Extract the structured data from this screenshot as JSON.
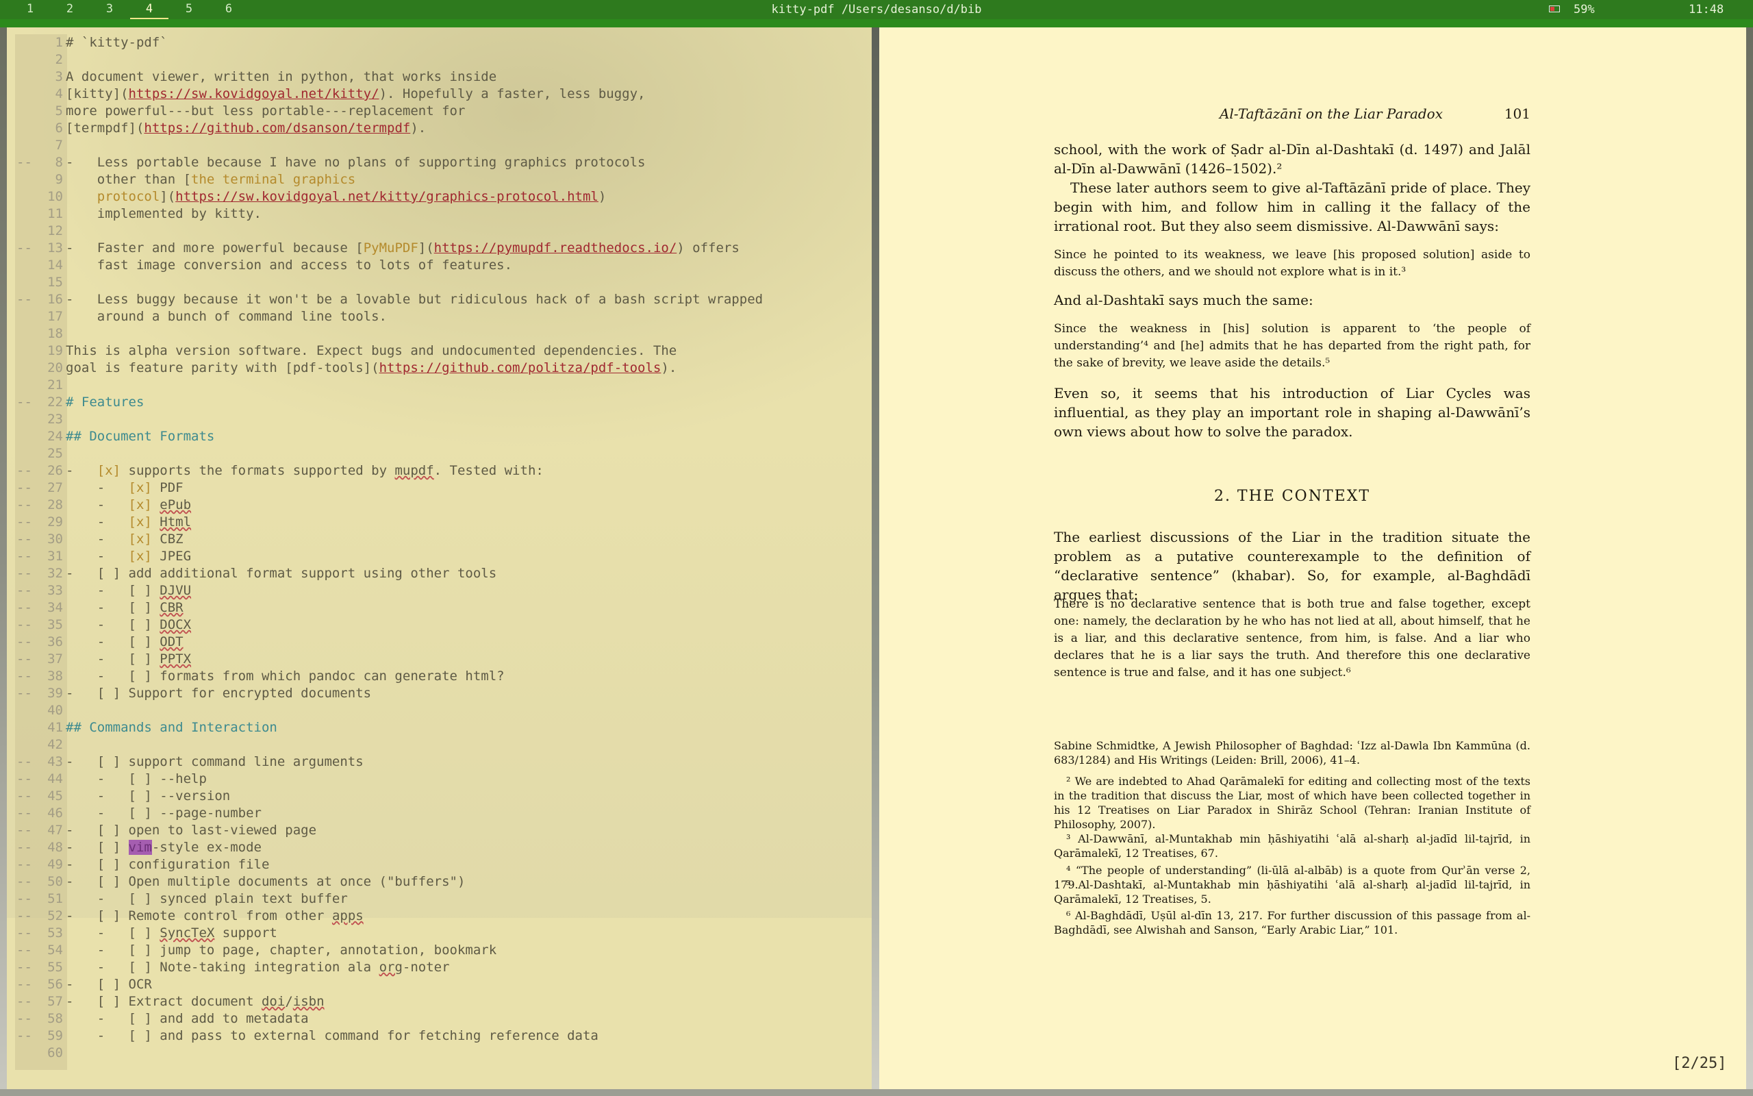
{
  "topbar": {
    "workspaces": [
      "1",
      "2",
      "3",
      "4",
      "5",
      "6"
    ],
    "active_workspace": "4",
    "window_title": "kitty-pdf /Users/desanso/d/bib",
    "battery": "59%",
    "clock": "11:48"
  },
  "editor": {
    "lines": [
      {
        "n": "1",
        "m": "",
        "t": [
          [
            "# `kitty-pdf`",
            ""
          ]
        ]
      },
      {
        "n": "2",
        "m": "",
        "t": []
      },
      {
        "n": "3",
        "m": "",
        "t": [
          [
            "A document viewer, written in python, that works inside",
            ""
          ]
        ]
      },
      {
        "n": "4",
        "m": "",
        "t": [
          [
            "[kitty](",
            ""
          ],
          [
            "https://sw.kovidgoyal.net/kitty/",
            "lnk"
          ],
          [
            "). Hopefully a faster, less buggy,",
            ""
          ]
        ]
      },
      {
        "n": "5",
        "m": "",
        "t": [
          [
            "more powerful---but less portable---replacement for",
            ""
          ]
        ]
      },
      {
        "n": "6",
        "m": "",
        "t": [
          [
            "[termpdf](",
            ""
          ],
          [
            "https://github.com/dsanson/termpdf",
            "lnk"
          ],
          [
            ").",
            ""
          ]
        ]
      },
      {
        "n": "7",
        "m": "",
        "t": []
      },
      {
        "n": "8",
        "m": "--",
        "t": [
          [
            "-   Less portable because I have no plans of supporting graphics protocols",
            ""
          ]
        ]
      },
      {
        "n": "9",
        "m": "",
        "t": [
          [
            "    other than [",
            ""
          ],
          [
            "the terminal graphics",
            "gld"
          ]
        ]
      },
      {
        "n": "10",
        "m": "",
        "t": [
          [
            "    ",
            ""
          ],
          [
            "protocol",
            "gld"
          ],
          [
            "](",
            ""
          ],
          [
            "https://sw.kovidgoyal.net/kitty/graphics-protocol.html",
            "lnk"
          ],
          [
            ")",
            ""
          ]
        ]
      },
      {
        "n": "11",
        "m": "",
        "t": [
          [
            "    implemented by kitty.",
            ""
          ]
        ]
      },
      {
        "n": "12",
        "m": "",
        "t": []
      },
      {
        "n": "13",
        "m": "--",
        "t": [
          [
            "-   Faster and more powerful because [",
            ""
          ],
          [
            "PyMuPDF",
            "gld"
          ],
          [
            "](",
            ""
          ],
          [
            "https://pymupdf.readthedocs.io/",
            "lnk"
          ],
          [
            ") offers",
            ""
          ]
        ]
      },
      {
        "n": "14",
        "m": "",
        "t": [
          [
            "    fast image conversion and access to lots of features.",
            ""
          ]
        ]
      },
      {
        "n": "15",
        "m": "",
        "t": []
      },
      {
        "n": "16",
        "m": "--",
        "t": [
          [
            "-   Less buggy because it won't be a lovable but ridiculous hack of a bash script wrapped",
            ""
          ]
        ]
      },
      {
        "n": "17",
        "m": "",
        "t": [
          [
            "    around a bunch of command line tools.",
            ""
          ]
        ]
      },
      {
        "n": "18",
        "m": "",
        "t": []
      },
      {
        "n": "19",
        "m": "",
        "t": [
          [
            "This is alpha version software. Expect bugs and undocumented dependencies. The",
            ""
          ]
        ]
      },
      {
        "n": "20",
        "m": "",
        "t": [
          [
            "goal is feature parity with [pdf-tools](",
            ""
          ],
          [
            "https://github.com/politza/pdf-tools",
            "lnk"
          ],
          [
            ").",
            ""
          ]
        ]
      },
      {
        "n": "21",
        "m": "",
        "t": []
      },
      {
        "n": "22",
        "m": "--",
        "t": [
          [
            "# Features",
            "h"
          ]
        ]
      },
      {
        "n": "23",
        "m": "",
        "t": []
      },
      {
        "n": "24",
        "m": "",
        "t": [
          [
            "## Document Formats",
            "h"
          ]
        ]
      },
      {
        "n": "25",
        "m": "",
        "t": []
      },
      {
        "n": "26",
        "m": "--",
        "t": [
          [
            "-   ",
            ""
          ],
          [
            "[x]",
            "gld"
          ],
          [
            " supports the formats supported by ",
            ""
          ],
          [
            "mupdf",
            "spl"
          ],
          [
            ". Tested with:",
            ""
          ]
        ]
      },
      {
        "n": "27",
        "m": "--",
        "t": [
          [
            "    -   ",
            ""
          ],
          [
            "[x]",
            "gld"
          ],
          [
            " PDF",
            ""
          ]
        ]
      },
      {
        "n": "28",
        "m": "--",
        "t": [
          [
            "    -   ",
            ""
          ],
          [
            "[x]",
            "gld"
          ],
          [
            " ",
            ""
          ],
          [
            "ePub",
            "spl"
          ]
        ]
      },
      {
        "n": "29",
        "m": "--",
        "t": [
          [
            "    -   ",
            ""
          ],
          [
            "[x]",
            "gld"
          ],
          [
            " ",
            ""
          ],
          [
            "Html",
            "spl"
          ]
        ]
      },
      {
        "n": "30",
        "m": "--",
        "t": [
          [
            "    -   ",
            ""
          ],
          [
            "[x]",
            "gld"
          ],
          [
            " CBZ",
            ""
          ]
        ]
      },
      {
        "n": "31",
        "m": "--",
        "t": [
          [
            "    -   ",
            ""
          ],
          [
            "[x]",
            "gld"
          ],
          [
            " JPEG",
            ""
          ]
        ]
      },
      {
        "n": "32",
        "m": "--",
        "t": [
          [
            "-   [ ] add additional format support using other tools",
            ""
          ]
        ]
      },
      {
        "n": "33",
        "m": "--",
        "t": [
          [
            "    -   [ ] ",
            ""
          ],
          [
            "DJVU",
            "spl"
          ]
        ]
      },
      {
        "n": "34",
        "m": "--",
        "t": [
          [
            "    -   [ ] ",
            ""
          ],
          [
            "CBR",
            "spl"
          ]
        ]
      },
      {
        "n": "35",
        "m": "--",
        "t": [
          [
            "    -   [ ] ",
            ""
          ],
          [
            "DOCX",
            "spl"
          ]
        ]
      },
      {
        "n": "36",
        "m": "--",
        "t": [
          [
            "    -   [ ] ",
            ""
          ],
          [
            "ODT",
            "spl"
          ]
        ]
      },
      {
        "n": "37",
        "m": "--",
        "t": [
          [
            "    -   [ ] ",
            ""
          ],
          [
            "PPTX",
            "spl"
          ]
        ]
      },
      {
        "n": "38",
        "m": "--",
        "t": [
          [
            "    -   [ ] formats from which pandoc can generate html?",
            ""
          ]
        ]
      },
      {
        "n": "39",
        "m": "--",
        "t": [
          [
            "-   [ ] Support for encrypted documents",
            ""
          ]
        ]
      },
      {
        "n": "40",
        "m": "",
        "t": []
      },
      {
        "n": "41",
        "m": "",
        "t": [
          [
            "## Commands and Interaction",
            "h"
          ]
        ]
      },
      {
        "n": "42",
        "m": "",
        "t": []
      },
      {
        "n": "43",
        "m": "--",
        "t": [
          [
            "-   [ ] support command line arguments",
            ""
          ]
        ]
      },
      {
        "n": "44",
        "m": "--",
        "t": [
          [
            "    -   [ ] --help",
            ""
          ]
        ]
      },
      {
        "n": "45",
        "m": "--",
        "t": [
          [
            "    -   [ ] --version",
            ""
          ]
        ]
      },
      {
        "n": "46",
        "m": "--",
        "t": [
          [
            "    -   [ ] --page-number",
            ""
          ]
        ]
      },
      {
        "n": "47",
        "m": "--",
        "t": [
          [
            "-   [ ] open to last-viewed page",
            ""
          ]
        ]
      },
      {
        "n": "48",
        "m": "--",
        "t": [
          [
            "-   [ ] ",
            ""
          ],
          [
            "vim",
            "hl"
          ],
          [
            "-style ex-mode",
            ""
          ]
        ]
      },
      {
        "n": "49",
        "m": "--",
        "t": [
          [
            "-   [ ] configuration file",
            ""
          ]
        ]
      },
      {
        "n": "50",
        "m": "--",
        "t": [
          [
            "-   [ ] Open multiple documents at once (\"buffers\")",
            ""
          ]
        ]
      },
      {
        "n": "51",
        "m": "--",
        "t": [
          [
            "    -   [ ] synced plain text buffer",
            ""
          ]
        ]
      },
      {
        "n": "52",
        "m": "--",
        "t": [
          [
            "-   [ ] Remote control from other ",
            ""
          ],
          [
            "apps",
            "spl"
          ]
        ]
      },
      {
        "n": "53",
        "m": "--",
        "t": [
          [
            "    -   [ ] ",
            ""
          ],
          [
            "SyncTeX",
            "spl"
          ],
          [
            " support",
            ""
          ]
        ]
      },
      {
        "n": "54",
        "m": "--",
        "t": [
          [
            "    -   [ ] jump to page, chapter, annotation, bookmark",
            ""
          ]
        ]
      },
      {
        "n": "55",
        "m": "--",
        "t": [
          [
            "    -   [ ] Note-taking integration ala ",
            ""
          ],
          [
            "org",
            "spl"
          ],
          [
            "-noter",
            ""
          ]
        ]
      },
      {
        "n": "56",
        "m": "--",
        "t": [
          [
            "-   [ ] OCR",
            ""
          ]
        ]
      },
      {
        "n": "57",
        "m": "--",
        "t": [
          [
            "-   [ ] Extract document ",
            ""
          ],
          [
            "doi",
            "spl"
          ],
          [
            "/",
            ""
          ],
          [
            "isbn",
            "spl"
          ]
        ]
      },
      {
        "n": "58",
        "m": "--",
        "t": [
          [
            "    -   [ ] and add to metadata",
            ""
          ]
        ]
      },
      {
        "n": "59",
        "m": "--",
        "t": [
          [
            "    -   [ ] and pass to external command for fetching reference data",
            ""
          ]
        ]
      },
      {
        "n": "60",
        "m": "",
        "t": []
      }
    ]
  },
  "pdf": {
    "running_title": "Al-Taftāzānī on the Liar Paradox",
    "page_number": "101",
    "para1": "school, with the work of Ṣadr al-Dīn al-Dashtakī (d. 1497) and Jalāl al-Dīn al-Dawwānī (1426–1502).²",
    "para2": "These later authors seem to give al-Taftāzānī pride of place. They begin with him, and follow him in calling it the fallacy of the irrational root. But they also seem dismissive. Al-Dawwānī says:",
    "quote1": "Since he pointed to its weakness, we leave [his proposed solution] aside to discuss the others, and we should not explore what is in it.³",
    "para3": "And al-Dashtakī says much the same:",
    "quote2": "Since the weakness in [his] solution is apparent to ‘the people of understanding’⁴ and [he] admits that he has departed from the right path, for the sake of brevity, we leave aside the details.⁵",
    "para4": "Even so, it seems that his introduction of Liar Cycles was influential, as they play an important role in shaping al-Dawwānī’s own views about how to solve the paradox.",
    "section_heading": "2. THE CONTEXT",
    "para5": "The earliest discussions of the Liar in the tradition situate the problem as a putative counterexample to the definition of “declarative sentence” (khabar). So, for example, al-Baghdādī argues that:",
    "quote3": "There is no declarative sentence that is both true and false together, except one: namely, the declaration by he who has not lied at all, about himself, that he is a liar, and this declarative sentence, from him, is false. And a liar who declares that he is a liar says the truth. And therefore this one declarative sentence is true and false, and it has one subject.⁶",
    "fn1": "Sabine Schmidtke, A Jewish Philosopher of Baghdad: ʿIzz al-Dawla Ibn Kammūna (d. 683/1284) and His Writings (Leiden: Brill, 2006), 41–4.",
    "fn2": "² We are indebted to Ahad Qarāmalekī for editing and collecting most of the texts in the tradition that discuss the Liar, most of which have been collected together in his 12 Treatises on Liar Paradox in Shirāz School (Tehran: Iranian Institute of Philosophy, 2007).",
    "fn3": "³ Al-Dawwānī, al-Muntakhab min ḥāshiyatihi ʿalā al-sharḥ al-jadīd lil-tajrīd, in Qarāmalekī, 12 Treatises, 67.",
    "fn4": "⁴ “The people of understanding” (li-ūlā al-albāb) is a quote from Qurʾān verse 2, 179.",
    "fn5": "⁵ Al-Dashtakī, al-Muntakhab min ḥāshiyatihi ʿalā al-sharḥ al-jadīd lil-tajrīd, in Qarāmalekī, 12 Treatises, 5.",
    "fn6": "⁶ Al-Baghdādī, Uṣūl al-dīn 13, 217. For further discussion of this passage from al-Baghdādī, see Alwishah and Sanson, “Early Arabic Liar,” 101.",
    "pager": "[2/25]"
  }
}
